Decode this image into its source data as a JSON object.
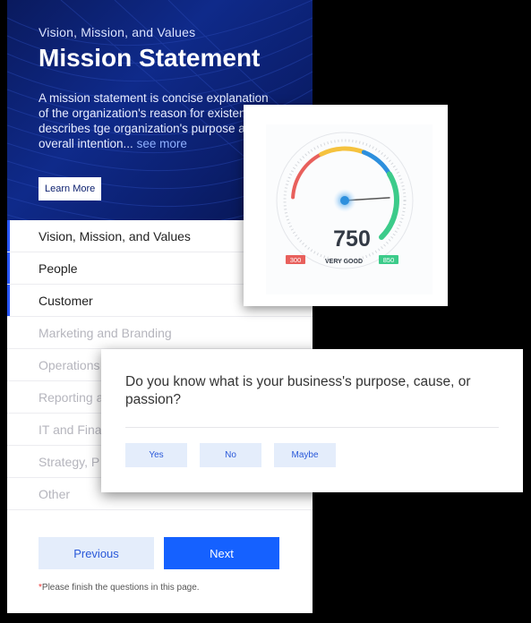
{
  "hero": {
    "subtitle": "Vision, Mission, and Values",
    "title": "Mission Statement",
    "description": "A mission statement is concise explanation of the organization's reason for existence. It describes tge organization's purpose and overall intention...",
    "see_more": "see more",
    "learn_more_label": "Learn More"
  },
  "nav": {
    "items": [
      {
        "label": "Vision, Mission, and Values",
        "state": "active"
      },
      {
        "label": "People",
        "state": "active"
      },
      {
        "label": "Customer",
        "state": "active"
      },
      {
        "label": "Marketing and Branding",
        "state": "inactive"
      },
      {
        "label": "Operations",
        "state": "inactive"
      },
      {
        "label": "Reporting and",
        "state": "inactive"
      },
      {
        "label": "IT and Finan",
        "state": "inactive"
      },
      {
        "label": "Strategy, P",
        "state": "inactive"
      },
      {
        "label": "Other",
        "state": "inactive"
      }
    ]
  },
  "footer": {
    "previous_label": "Previous",
    "next_label": "Next",
    "note_star": "*",
    "note": "Please finish the questions in this page."
  },
  "gauge": {
    "score": "750",
    "rating": "VERY GOOD",
    "min": "300",
    "max": "850",
    "value_fraction": 0.82,
    "colors": {
      "low": "#e8605c",
      "mid": "#f5c23e",
      "high": "#3ccb8a",
      "accent": "#2d8fdd"
    }
  },
  "question": {
    "text": "Do you know what is your business's purpose, cause, or passion?",
    "answers": {
      "yes": "Yes",
      "no": "No",
      "maybe": "Maybe"
    }
  }
}
